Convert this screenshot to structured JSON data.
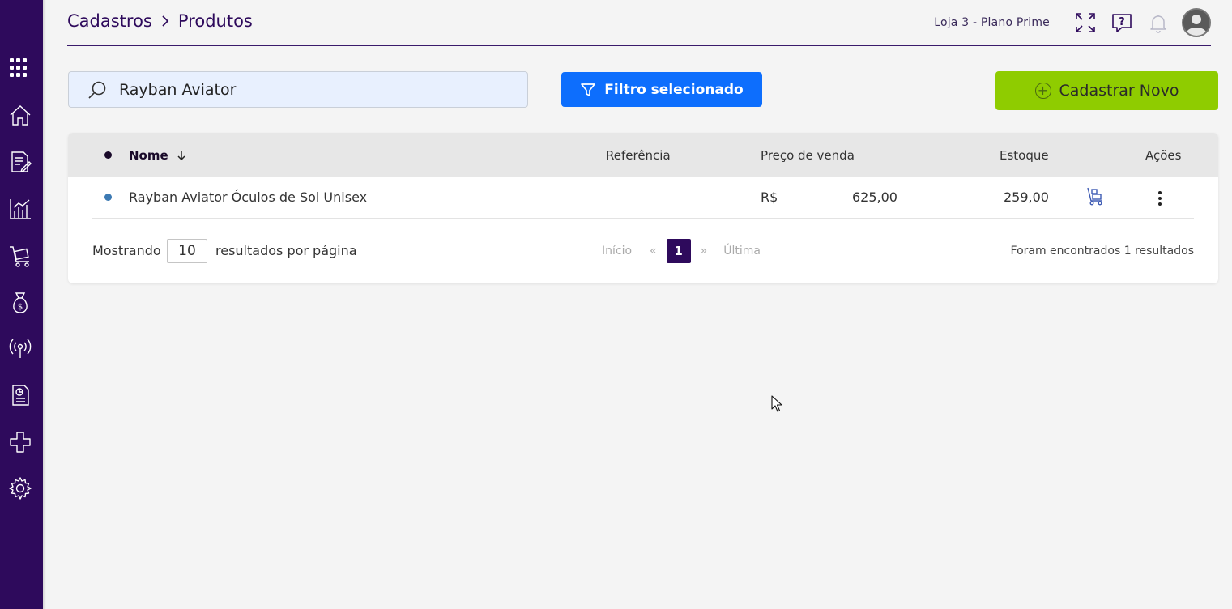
{
  "sidebar": {
    "items": [
      {
        "icon": "apps-grid-icon"
      },
      {
        "icon": "home-icon"
      },
      {
        "icon": "document-edit-icon"
      },
      {
        "icon": "chart-icon"
      },
      {
        "icon": "cart-icon"
      },
      {
        "icon": "money-bag-icon"
      },
      {
        "icon": "broadcast-icon"
      },
      {
        "icon": "report-icon"
      },
      {
        "icon": "integrations-icon"
      },
      {
        "icon": "settings-gear-icon"
      }
    ]
  },
  "header": {
    "breadcrumb": [
      "Cadastros",
      "Produtos"
    ],
    "store": "Loja 3 - Plano Prime"
  },
  "search": {
    "value": "Rayban Aviator"
  },
  "filter_button": {
    "label": "Filtro selecionado"
  },
  "new_button": {
    "label": "Cadastrar Novo"
  },
  "table": {
    "columns": {
      "name": "Nome",
      "reference": "Referência",
      "price": "Preço de venda",
      "stock": "Estoque",
      "actions": "Ações"
    },
    "rows": [
      {
        "name": "Rayban Aviator Óculos de Sol Unisex",
        "reference": "",
        "currency": "R$",
        "price": "625,00",
        "stock": "259,00"
      }
    ]
  },
  "pagination": {
    "showing": "Mostrando",
    "per_page": "10",
    "per_page_suffix": "resultados por página",
    "first": "Início",
    "prev": "«",
    "current": "1",
    "next": "»",
    "last": "Última",
    "found": "Foram encontrados 1 resultados"
  },
  "colors": {
    "sidebar": "#2e0a5c",
    "filter_button": "#0d6efd",
    "new_button": "#8fcc00",
    "active_page": "#2e0a5c"
  }
}
